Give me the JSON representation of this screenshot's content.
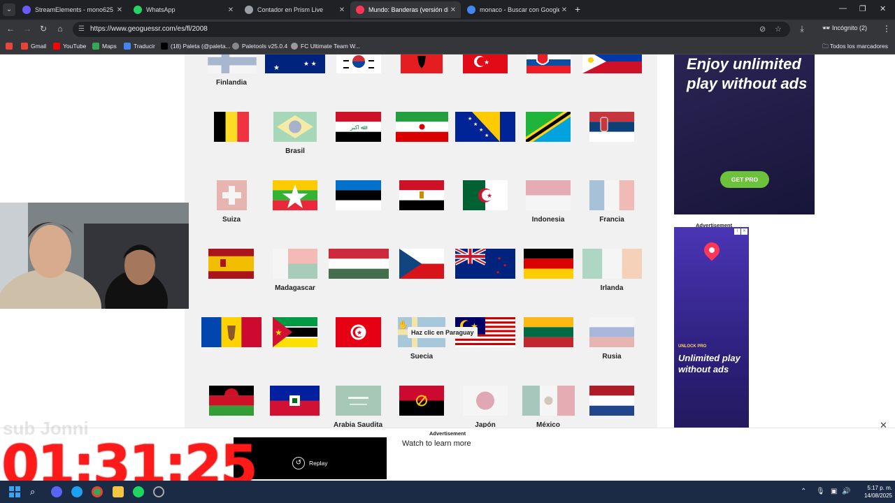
{
  "browser": {
    "tabs": [
      {
        "title": "StreamElements - mono625",
        "color": "#6b5bff"
      },
      {
        "title": "WhatsApp",
        "color": "#25d366"
      },
      {
        "title": "Contador en Prism Live",
        "color": "#9aa0a6"
      },
      {
        "title": "Mundo: Banderas (versión difíc",
        "color": "#ff3656"
      },
      {
        "title": "monaco - Buscar con Google",
        "color": "#4285f4"
      }
    ],
    "url": "https://www.geoguessr.com/es/fl/2008",
    "incognito_label": "Incógnito (2)",
    "bookmarks": [
      {
        "label": "Gmail",
        "color": "#ea4335"
      },
      {
        "label": "YouTube",
        "color": "#ff0000"
      },
      {
        "label": "Maps",
        "color": "#34a853"
      },
      {
        "label": "Traducir",
        "color": "#4285f4"
      },
      {
        "label": "(18) Paleta (@paleta...",
        "color": "#000000"
      },
      {
        "label": "Paletools v25.0.4",
        "color": "#888888"
      },
      {
        "label": "FC Ultimate Team W...",
        "color": "#999999"
      }
    ],
    "all_bookmarks_label": "Todos los marcadores"
  },
  "quiz": {
    "labels": {
      "finlandia": "Finlandia",
      "brasil": "Brasil",
      "suiza": "Suiza",
      "indonesia": "Indonesia",
      "francia": "Francia",
      "madagascar": "Madagascar",
      "irlanda": "Irlanda",
      "suecia": "Suecia",
      "rusia": "Rusia",
      "arabia": "Arabia Saudita",
      "japon": "Japón",
      "mexico": "México"
    },
    "tooltip": "Haz clic en Paraguay"
  },
  "ads": {
    "top_text": "Enjoy unlimited play without ads",
    "get_pro": "GET PRO",
    "advertisement": "Advertisement",
    "side_unlock": "UNLOCK PRO",
    "side_text": "Unlimited play without ads",
    "bottom_label": "Advertisement",
    "replay": "Replay",
    "watch": "Watch to learn more"
  },
  "overlay": {
    "timer": "01:31:25",
    "ghost_text": "sub Jonni"
  },
  "taskbar": {
    "time": "5:17 p. m.",
    "date": "14/08/2025"
  }
}
